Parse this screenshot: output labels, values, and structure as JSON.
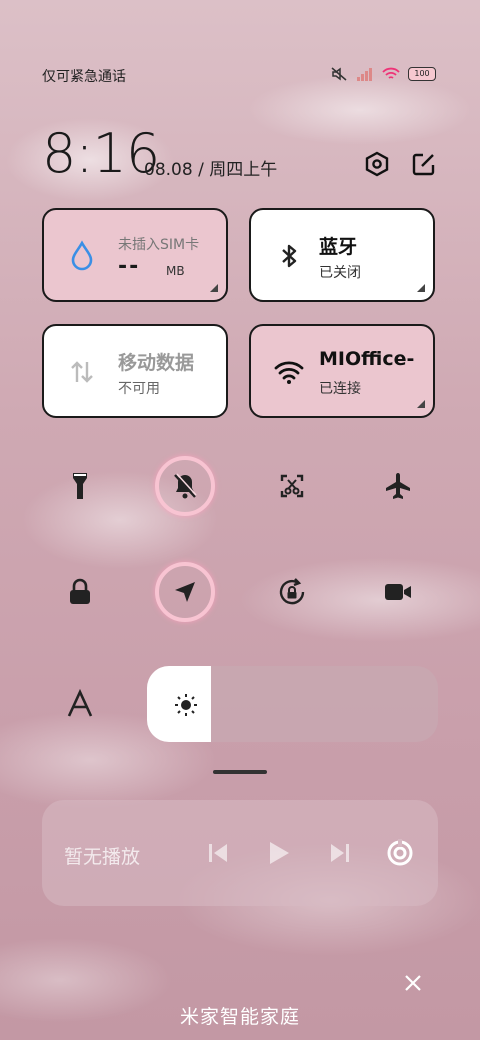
{
  "status_bar": {
    "left_text": "仅可紧急通话",
    "battery": "100",
    "icons": [
      "mute-icon",
      "signal-icon",
      "wifi-icon",
      "battery-icon"
    ]
  },
  "header": {
    "time": "8:16",
    "date": "08.08 / 周四上午",
    "icons": [
      "settings-hexagon-icon",
      "edit-icon"
    ]
  },
  "tiles": [
    {
      "title": "未插入SIM卡",
      "value": "--",
      "unit": "MB",
      "icon": "water-drop-icon"
    },
    {
      "title": "蓝牙",
      "sub": "已关闭",
      "icon": "bluetooth-icon"
    },
    {
      "title": "移动数据",
      "sub": "不可用",
      "icon": "mobile-data-icon"
    },
    {
      "title": "MIOffice-",
      "sub": "已连接",
      "icon": "wifi-icon"
    }
  ],
  "toggles_row1": [
    "flashlight-icon",
    "mute-bell-icon",
    "screenshot-icon",
    "airplane-icon"
  ],
  "toggles_row2": [
    "lock-icon",
    "location-icon",
    "rotation-lock-icon",
    "video-camera-icon"
  ],
  "brightness": {
    "level": 0.22,
    "icon": "sun-icon",
    "auto_icon": "font-a-icon"
  },
  "media": {
    "label": "暂无播放",
    "icons": [
      "previous-icon",
      "play-icon",
      "next-icon",
      "cast-icon"
    ]
  },
  "footer": {
    "label": "米家智能家庭",
    "close_icon": "close-icon"
  },
  "colors": {
    "tile_pink": "#ebc6cf",
    "ring_pink": "#f8c4d2",
    "accent_blue": "#3a8fe6"
  }
}
